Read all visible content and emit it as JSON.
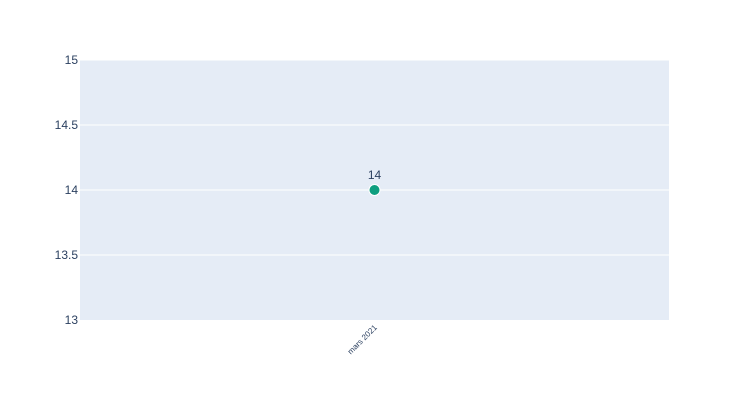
{
  "chart_data": {
    "type": "scatter",
    "title": "",
    "xlabel": "",
    "ylabel": "",
    "categories": [
      "mars 2021"
    ],
    "series": [
      {
        "values": [
          14
        ],
        "data_labels": [
          "14"
        ],
        "color": "#0d9e7f"
      }
    ],
    "y_ticks": [
      13,
      13.5,
      14,
      14.5,
      15
    ],
    "y_tick_labels": [
      "13",
      "13.5",
      "14",
      "14.5",
      "15"
    ],
    "ylim": [
      13,
      15
    ],
    "grid": true,
    "legend": "none",
    "colors": {
      "plot_background": "#e5ecf6",
      "grid": "#ffffff",
      "text": "#2a3f5f",
      "marker": "#0d9e7f"
    }
  }
}
